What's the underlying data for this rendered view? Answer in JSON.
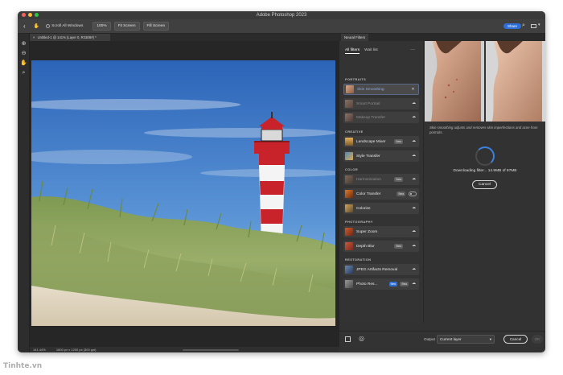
{
  "app": {
    "title": "Adobe Photoshop 2023"
  },
  "options_bar": {
    "scroll_all_windows": "Scroll All Windows",
    "zoom_100": "100%",
    "fit_screen": "Fit Screen",
    "fill_screen": "Fill Screen",
    "share": "Share"
  },
  "document": {
    "tab_title": "Untitled-1 @ 141% (Layer 0, RGB/8#) *",
    "status_zoom": "141.44%",
    "status_info": "1800 px x 1200 px (300 ppi)"
  },
  "panel": {
    "title": "Neural Filters",
    "tabs": [
      "All filters",
      "Wait list"
    ],
    "more": "···",
    "categories": {
      "portraits": "PORTRAITS",
      "creative": "CREATIVE",
      "color": "COLOR",
      "photography": "PHOTOGRAPHY",
      "restoration": "RESTORATION"
    },
    "filters": {
      "skin_smoothing": "Skin Smoothing",
      "smart_portrait": "Smart Portrait",
      "makeup_transfer": "Makeup Transfer",
      "landscape_mixer": "Landscape Mixer",
      "style_transfer": "Style Transfer",
      "harmonization": "Harmonization",
      "color_transfer": "Color Transfer",
      "colorize": "Colorize",
      "super_zoom": "Super Zoom",
      "depth_blur": "Depth Blur",
      "jpeg_artifacts": "JPEG Artifacts Removal",
      "photo_restoration": "Photo Res..."
    },
    "badges": {
      "beta": "Beta",
      "new": "New"
    },
    "description": "Skin smoothing adjusts and removes skin imperfections and acne from portraits.",
    "download_status": "Downloading filter... 14.9MB of 97MB",
    "cancel": "Cancel",
    "output_label": "Output",
    "output_value": "Current layer",
    "footer_cancel": "Cancel",
    "footer_ok": "OK"
  },
  "colors": {
    "accent": "#2d6fd6",
    "panel_bg": "#333333",
    "lighthouse_red": "#c8232a"
  },
  "watermark": "Tinhte.vn"
}
